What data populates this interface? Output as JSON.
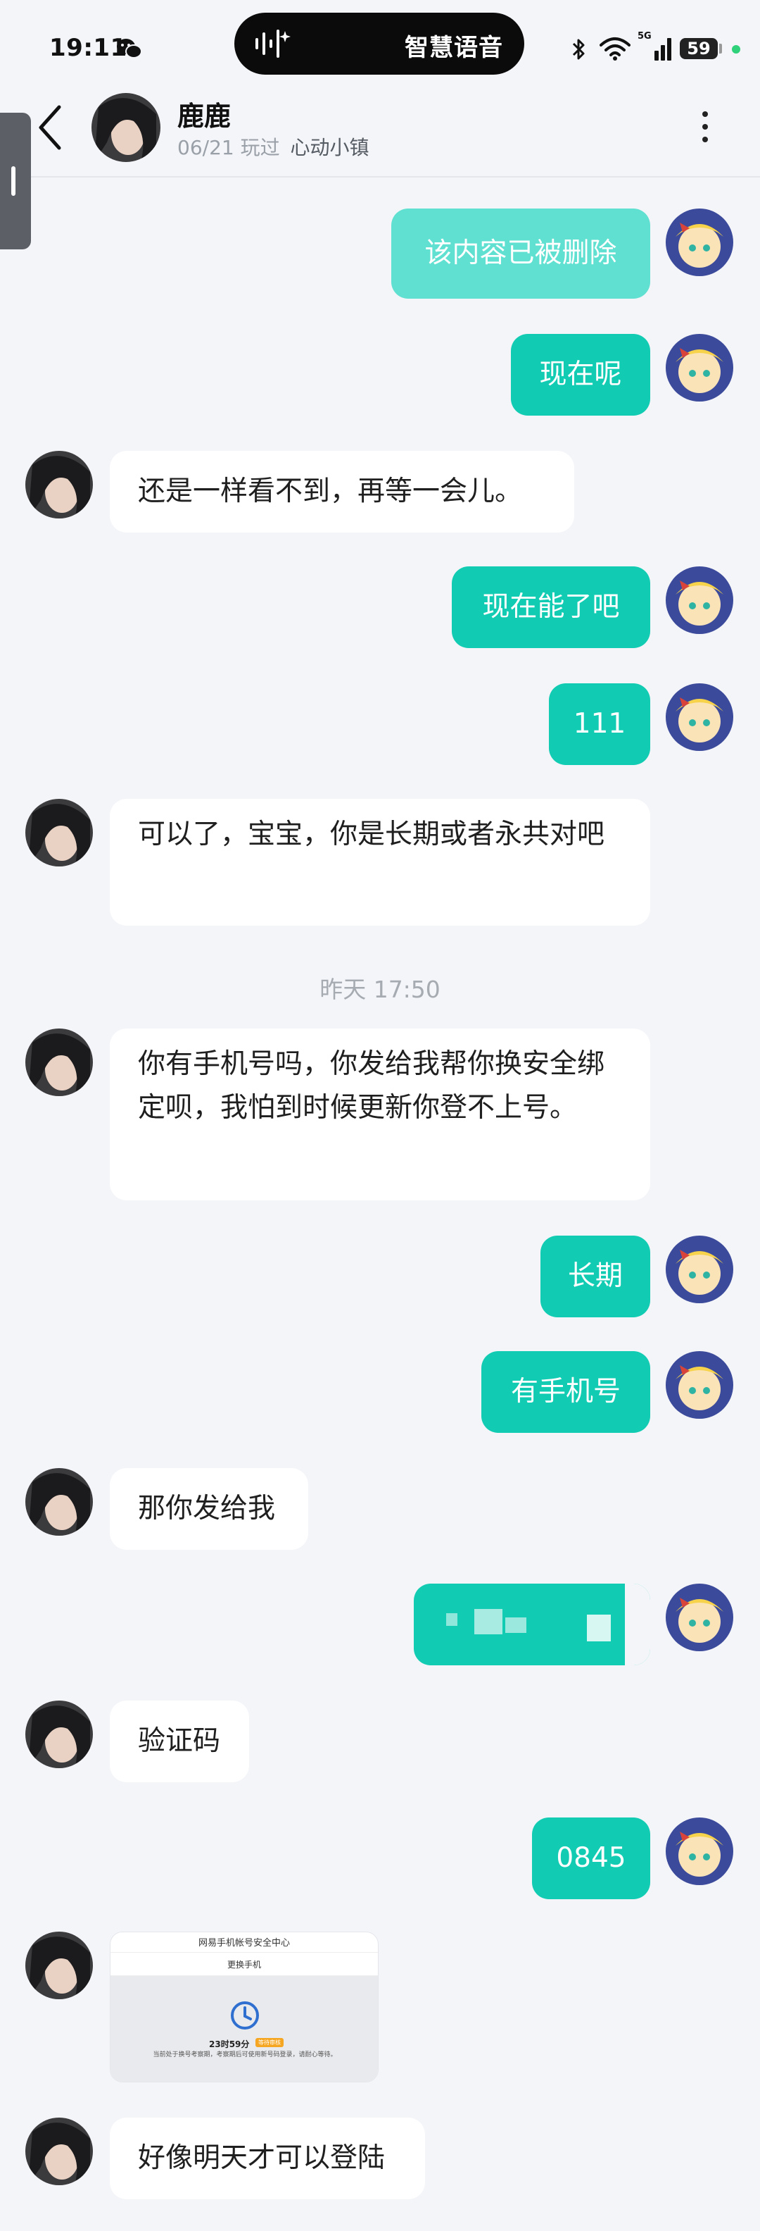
{
  "status_bar": {
    "time": "19:11",
    "island_text": "智慧语音",
    "network": "5G",
    "battery": "59",
    "icons": [
      "wechat-icon",
      "voice-wave-icon",
      "bluetooth-icon",
      "wifi-icon",
      "signal-icon",
      "battery-icon"
    ]
  },
  "header": {
    "name": "鹿鹿",
    "date": "06/21",
    "played_label": "玩过",
    "game": "心动小镇"
  },
  "colors": {
    "outgoing_bubble": "#11ccb3",
    "incoming_bubble": "#ffffff",
    "background": "#f4f5f9",
    "timestamp": "#a6abb2"
  },
  "messages": {
    "m1": "该内容已被删除",
    "m2": "现在呢",
    "m3": "还是一样看不到，再等一会儿。",
    "m4": "现在能了吧",
    "m5": "111",
    "m6": "可以了，宝宝，你是长期或者永共对吧",
    "timestamp": "昨天  17:50",
    "m7": "你有手机号吗，你发给我帮你换安全绑定呗，我怕到时候更新你登不上号。",
    "m8": "长期",
    "m9": "有手机号",
    "m10": "那你发给我",
    "m12": "验证码",
    "m13": "0845",
    "m15": "好像明天才可以登陆"
  },
  "image_message": {
    "title": "网易手机帐号安全中心",
    "subtitle": "更换手机",
    "timer": "23时59分",
    "badge": "等待审核",
    "note": "当前处于换号考察期，考察期后可使用新号码登录，请耐心等待。"
  }
}
